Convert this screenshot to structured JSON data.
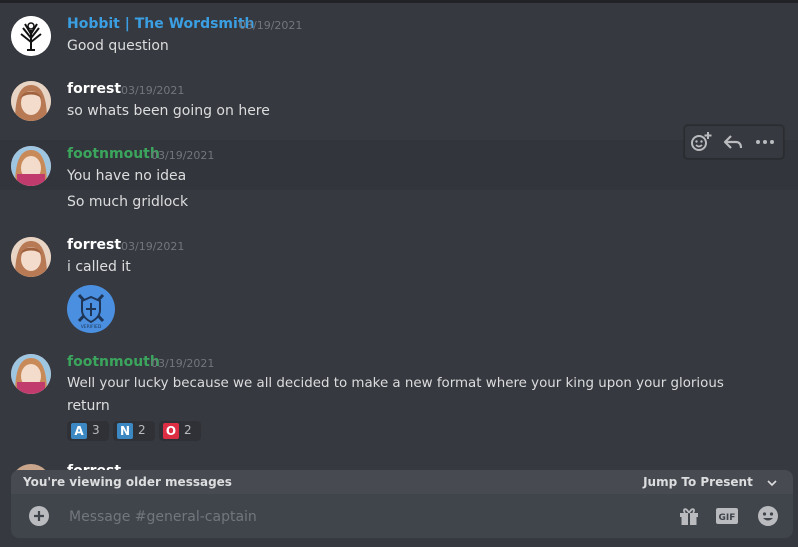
{
  "colors": {
    "background": "#36393f",
    "hobbit_name": "#3b9fe3",
    "forrest_name": "#ffffff",
    "footnmouth_name": "#3ba55d",
    "timestamp": "#72767d"
  },
  "messages": [
    {
      "author": "Hobbit | The Wordsmith",
      "timestamp": "03/19/2021",
      "lines": [
        "Good question"
      ]
    },
    {
      "author": "forrest",
      "timestamp": "03/19/2021",
      "lines": [
        "so whats been going on here"
      ]
    },
    {
      "author": "footnmouth",
      "timestamp": "03/19/2021",
      "lines": [
        "You have no idea",
        "So much gridlock"
      ]
    },
    {
      "author": "forrest",
      "timestamp": "03/19/2021",
      "lines": [
        "i called it"
      ],
      "sticker_caption": "VERIFIED"
    },
    {
      "author": "footnmouth",
      "timestamp": "03/19/2021",
      "lines": [
        "Well your lucky because we all decided to make a new format where your king upon your glorious",
        "return"
      ]
    },
    {
      "author": "forrest"
    }
  ],
  "reactions": [
    {
      "emoji": "A",
      "count": "3",
      "color": "#3b88c3"
    },
    {
      "emoji": "N",
      "count": "2",
      "color": "#3b88c3"
    },
    {
      "emoji": "O",
      "count": "2",
      "color": "#dd2e44"
    }
  ],
  "hover_toolbar": {
    "icons": [
      "add-reaction-icon",
      "reply-icon",
      "more-icon"
    ]
  },
  "older_bar": {
    "text": "You're viewing older messages",
    "jump_label": "Jump To Present"
  },
  "composer": {
    "placeholder": "Message #general-captain",
    "icons": [
      "plus-circle-icon",
      "gift-icon",
      "gif-icon",
      "emoji-icon"
    ]
  }
}
